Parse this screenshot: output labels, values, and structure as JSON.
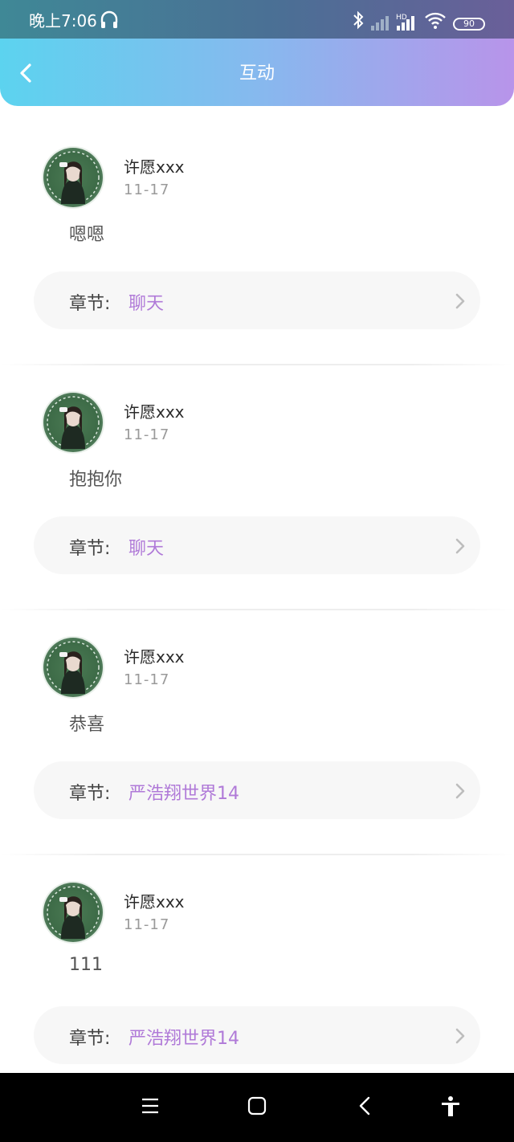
{
  "status_bar": {
    "time": "晚上7:06",
    "battery": "90"
  },
  "header": {
    "title": "互动"
  },
  "chapter_label": "章节:",
  "items": [
    {
      "username": "许愿xxx",
      "date": "11-17",
      "comment": "嗯嗯",
      "chapter": "聊天"
    },
    {
      "username": "许愿xxx",
      "date": "11-17",
      "comment": "抱抱你",
      "chapter": "聊天"
    },
    {
      "username": "许愿xxx",
      "date": "11-17",
      "comment": "恭喜",
      "chapter": "严浩翔世界14"
    },
    {
      "username": "许愿xxx",
      "date": "11-17",
      "comment": "111",
      "chapter": "严浩翔世界14"
    }
  ],
  "icons": {
    "back": "chevron-left-icon",
    "headphones": "headphones-icon",
    "bluetooth": "bluetooth-icon",
    "signal": "signal-icon",
    "wifi": "wifi-icon",
    "battery": "battery-icon",
    "menu": "menu-icon",
    "home": "home-square-icon",
    "nav_back": "nav-back-icon",
    "accessibility": "accessibility-icon"
  },
  "colors": {
    "header_start": "#5cd3ef",
    "header_end": "#b894ea",
    "chapter_name": "#b07ad8"
  }
}
